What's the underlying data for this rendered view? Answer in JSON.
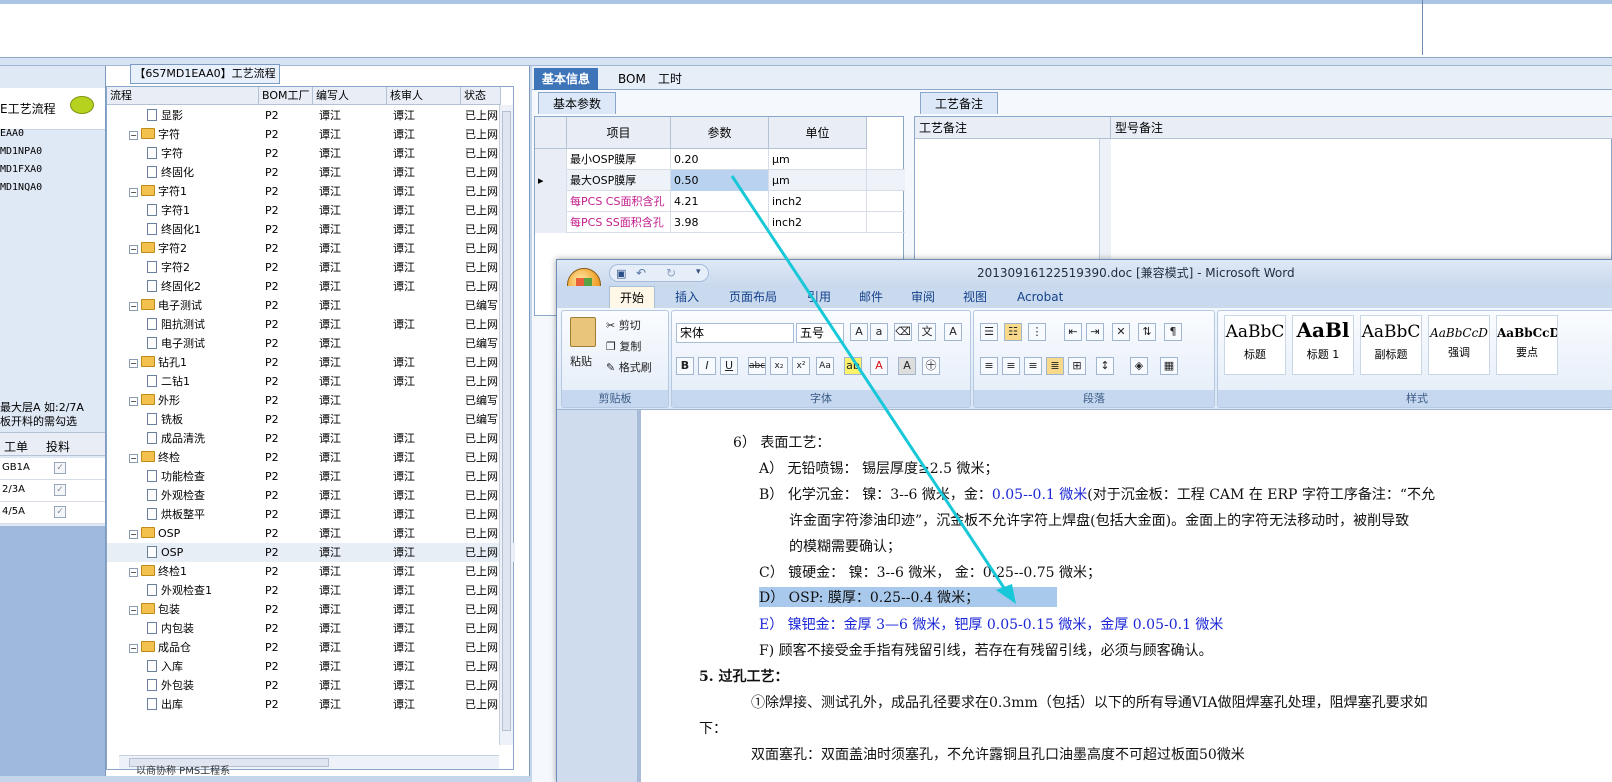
{
  "left": {
    "head_label": "E工艺流程",
    "items": [
      "EAA0",
      "MD1NPA0",
      "MD1FXA0",
      "MD1NQA0"
    ],
    "note1": "最大层A 如:2/7A",
    "note2": "板开料的需勾选",
    "col_job": "工单",
    "col_feed": "投料",
    "rows": [
      "GB1A",
      "2/3A",
      "4/5A"
    ]
  },
  "tree": {
    "title": "【6S7MD1EAA0】工艺流程",
    "headers": [
      "流程",
      "BOM工厂",
      "编写人",
      "核审人",
      "状态"
    ],
    "rows": [
      {
        "level": 2,
        "type": "doc",
        "name": "显影",
        "bom": "P2",
        "writer": "谭江",
        "checker": "谭江",
        "status": "已上网"
      },
      {
        "level": 1,
        "type": "folder",
        "name": "字符",
        "bom": "P2",
        "writer": "谭江",
        "checker": "谭江",
        "status": "已上网"
      },
      {
        "level": 2,
        "type": "doc",
        "name": "字符",
        "bom": "P2",
        "writer": "谭江",
        "checker": "谭江",
        "status": "已上网"
      },
      {
        "level": 2,
        "type": "doc",
        "name": "终固化",
        "bom": "P2",
        "writer": "谭江",
        "checker": "谭江",
        "status": "已上网"
      },
      {
        "level": 1,
        "type": "folder",
        "name": "字符1",
        "bom": "P2",
        "writer": "谭江",
        "checker": "谭江",
        "status": "已上网"
      },
      {
        "level": 2,
        "type": "doc",
        "name": "字符1",
        "bom": "P2",
        "writer": "谭江",
        "checker": "谭江",
        "status": "已上网"
      },
      {
        "level": 2,
        "type": "doc",
        "name": "终固化1",
        "bom": "P2",
        "writer": "谭江",
        "checker": "谭江",
        "status": "已上网"
      },
      {
        "level": 1,
        "type": "folder",
        "name": "字符2",
        "bom": "P2",
        "writer": "谭江",
        "checker": "谭江",
        "status": "已上网"
      },
      {
        "level": 2,
        "type": "doc",
        "name": "字符2",
        "bom": "P2",
        "writer": "谭江",
        "checker": "谭江",
        "status": "已上网"
      },
      {
        "level": 2,
        "type": "doc",
        "name": "终固化2",
        "bom": "P2",
        "writer": "谭江",
        "checker": "谭江",
        "status": "已上网"
      },
      {
        "level": 1,
        "type": "folder",
        "name": "电子测试",
        "bom": "P2",
        "writer": "谭江",
        "checker": "",
        "status": "已编写"
      },
      {
        "level": 2,
        "type": "doc",
        "name": "阻抗测试",
        "bom": "P2",
        "writer": "谭江",
        "checker": "谭江",
        "status": "已上网"
      },
      {
        "level": 2,
        "type": "doc",
        "name": "电子测试",
        "bom": "P2",
        "writer": "谭江",
        "checker": "",
        "status": "已编写"
      },
      {
        "level": 1,
        "type": "folder",
        "name": "钻孔1",
        "bom": "P2",
        "writer": "谭江",
        "checker": "谭江",
        "status": "已上网"
      },
      {
        "level": 2,
        "type": "doc",
        "name": "二钻1",
        "bom": "P2",
        "writer": "谭江",
        "checker": "谭江",
        "status": "已上网"
      },
      {
        "level": 1,
        "type": "folder",
        "name": "外形",
        "bom": "P2",
        "writer": "谭江",
        "checker": "",
        "status": "已编写"
      },
      {
        "level": 2,
        "type": "doc",
        "name": "铣板",
        "bom": "P2",
        "writer": "谭江",
        "checker": "",
        "status": "已编写"
      },
      {
        "level": 2,
        "type": "doc",
        "name": "成品清洗",
        "bom": "P2",
        "writer": "谭江",
        "checker": "谭江",
        "status": "已上网"
      },
      {
        "level": 1,
        "type": "folder",
        "name": "终检",
        "bom": "P2",
        "writer": "谭江",
        "checker": "谭江",
        "status": "已上网"
      },
      {
        "level": 2,
        "type": "doc",
        "name": "功能检查",
        "bom": "P2",
        "writer": "谭江",
        "checker": "谭江",
        "status": "已上网"
      },
      {
        "level": 2,
        "type": "doc",
        "name": "外观检查",
        "bom": "P2",
        "writer": "谭江",
        "checker": "谭江",
        "status": "已上网"
      },
      {
        "level": 2,
        "type": "doc",
        "name": "烘板整平",
        "bom": "P2",
        "writer": "谭江",
        "checker": "谭江",
        "status": "已上网"
      },
      {
        "level": 1,
        "type": "folder",
        "name": "OSP",
        "bom": "P2",
        "writer": "谭江",
        "checker": "谭江",
        "status": "已上网"
      },
      {
        "level": 2,
        "type": "doc",
        "name": "OSP",
        "bom": "P2",
        "writer": "谭江",
        "checker": "谭江",
        "status": "已上网",
        "selected": true
      },
      {
        "level": 1,
        "type": "folder",
        "name": "终检1",
        "bom": "P2",
        "writer": "谭江",
        "checker": "谭江",
        "status": "已上网"
      },
      {
        "level": 2,
        "type": "doc",
        "name": "外观检查1",
        "bom": "P2",
        "writer": "谭江",
        "checker": "谭江",
        "status": "已上网"
      },
      {
        "level": 1,
        "type": "folder",
        "name": "包装",
        "bom": "P2",
        "writer": "谭江",
        "checker": "谭江",
        "status": "已上网"
      },
      {
        "level": 2,
        "type": "doc",
        "name": "内包装",
        "bom": "P2",
        "writer": "谭江",
        "checker": "谭江",
        "status": "已上网"
      },
      {
        "level": 1,
        "type": "folder",
        "name": "成品仓",
        "bom": "P2",
        "writer": "谭江",
        "checker": "谭江",
        "status": "已上网"
      },
      {
        "level": 2,
        "type": "doc",
        "name": "入库",
        "bom": "P2",
        "writer": "谭江",
        "checker": "谭江",
        "status": "已上网"
      },
      {
        "level": 2,
        "type": "doc",
        "name": "外包装",
        "bom": "P2",
        "writer": "谭江",
        "checker": "谭江",
        "status": "已上网"
      },
      {
        "level": 2,
        "type": "doc",
        "name": "出库",
        "bom": "P2",
        "writer": "谭江",
        "checker": "谭江",
        "status": "已上网"
      }
    ],
    "status_bar": "以商协称  PMS工程系"
  },
  "right": {
    "tabs": [
      "基本信息",
      "BOM",
      "工时"
    ],
    "sub_params": "基本参数",
    "sub_notes": "工艺备注",
    "param_headers": [
      "项目",
      "参数",
      "单位"
    ],
    "params": [
      {
        "item": "最小OSP膜厚",
        "value": "0.20",
        "unit": "μm",
        "pink": false
      },
      {
        "item": "最大OSP膜厚",
        "value": "0.50",
        "unit": "μm",
        "pink": false,
        "current": true
      },
      {
        "item": "每PCS CS面积含孔",
        "value": "4.21",
        "unit": "inch2",
        "pink": true
      },
      {
        "item": "每PCS SS面积含孔",
        "value": "3.98",
        "unit": "inch2",
        "pink": true
      }
    ],
    "note_headers": [
      "工艺备注",
      "型号备注"
    ]
  },
  "word": {
    "caption": "20130916122519390.doc [兼容模式] - Microsoft Word",
    "tabs": [
      "开始",
      "插入",
      "页面布局",
      "引用",
      "邮件",
      "审阅",
      "视图",
      "Acrobat"
    ],
    "clipboard": {
      "paste": "粘贴",
      "cut": "剪切",
      "copy": "复制",
      "format": "格式刷",
      "label": "剪贴板"
    },
    "font": {
      "name": "宋体",
      "size": "五号",
      "label": "字体"
    },
    "paragraph_label": "段落",
    "styles": [
      {
        "preview": "AaBbC",
        "name": "标题"
      },
      {
        "preview": "AaBl",
        "name": "标题 1"
      },
      {
        "preview": "AaBbC",
        "name": "副标题"
      },
      {
        "preview": "AaBbCcD",
        "name": "强调"
      },
      {
        "preview": "AaBbCcD",
        "name": "要点"
      }
    ],
    "styles_label": "样式",
    "lines": [
      "6） 表面工艺：",
      "A） 无铅喷锡： 锡层厚度≥2.5 微米；",
      "B） 化学沉金： 镍：3--6 微米，金：",
      "0.05--0.1 微米",
      "(对于沉金板：工程 CAM 在 ERP 字符工序备注：“不允",
      "许金面字符渗油印迹”，沉金板不允许字符上焊盘(包括大金面)。金面上的字符无法移动时，被削导致",
      "的模糊需要确认；",
      "C） 镀硬金：   镍：3--6 微米， 金：0.25--0.75 微米；",
      "D） OSP:      膜厚：0.25--0.4 微米；",
      "E） 镍钯金：金厚 3—6 微米，钯厚 0.05-0.15 微米，金厚 0.05-0.1 微米",
      "F) 顾客不接受金手指有残留引线，若存在有残留引线，必须与顾客确认。",
      "5.   过孔工艺：",
      "①除焊接、测试孔外，成品孔径要求在0.3mm（包括）以下的所有导通VIA做阻焊塞孔处理，阻焊塞孔要求如",
      "下：",
      "双面塞孔：双面盖油时须塞孔，不允许露铜且孔口油墨高度不可超过板面50微米"
    ]
  },
  "colors": {
    "accent": "#3e74b8",
    "pink": "#c21c8c",
    "blue_text": "#1b27d6",
    "arrow": "#19c8d8",
    "highlight": "#a8c8ec"
  }
}
